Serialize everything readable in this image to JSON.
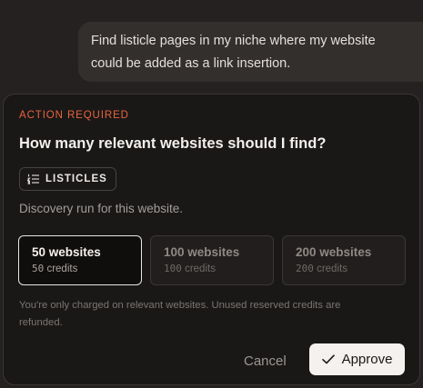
{
  "chat": {
    "user_message": "Find listicle pages in my niche where my website could be added as a link insertion."
  },
  "card": {
    "action_label": "ACTION REQUIRED",
    "question": "How many relevant websites should I find?",
    "tag": {
      "label": "LISTICLES",
      "icon": "list-ordered-icon"
    },
    "description": "Discovery run for this website.",
    "options": [
      {
        "count": "50",
        "title": "50 websites",
        "credits_value": "50",
        "credits_unit": "credits",
        "selected": true
      },
      {
        "count": "100",
        "title": "100 websites",
        "credits_value": "100",
        "credits_unit": "credits",
        "selected": false
      },
      {
        "count": "200",
        "title": "200 websites",
        "credits_value": "200",
        "credits_unit": "credits",
        "selected": false
      }
    ],
    "note": "You're only charged on relevant websites. Unused reserved credits are refunded.",
    "cancel_label": "Cancel",
    "approve_label": "Approve",
    "approve_icon": "check-icon"
  },
  "colors": {
    "background": "#242120",
    "card": "#1a1817",
    "accent": "#e8643e",
    "primary_button": "#f4f1ee"
  }
}
